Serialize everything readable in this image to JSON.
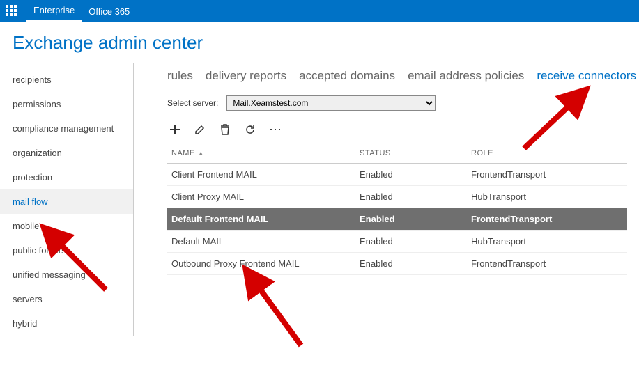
{
  "topbar": {
    "tabs": [
      "Enterprise",
      "Office 365"
    ],
    "active": 0
  },
  "page_title": "Exchange admin center",
  "sidebar": {
    "items": [
      "recipients",
      "permissions",
      "compliance management",
      "organization",
      "protection",
      "mail flow",
      "mobile",
      "public folders",
      "unified messaging",
      "servers",
      "hybrid"
    ],
    "active_index": 5
  },
  "main": {
    "tabs": [
      "rules",
      "delivery reports",
      "accepted domains",
      "email address policies",
      "receive connectors"
    ],
    "active_tab_index": 4,
    "server_label": "Select server:",
    "server_value": "Mail.Xeamstest.com",
    "table": {
      "columns": [
        "NAME",
        "STATUS",
        "ROLE"
      ],
      "rows": [
        {
          "name": "Client Frontend MAIL",
          "status": "Enabled",
          "role": "FrontendTransport",
          "selected": false
        },
        {
          "name": "Client Proxy MAIL",
          "status": "Enabled",
          "role": "HubTransport",
          "selected": false
        },
        {
          "name": "Default Frontend MAIL",
          "status": "Enabled",
          "role": "FrontendTransport",
          "selected": true
        },
        {
          "name": "Default MAIL",
          "status": "Enabled",
          "role": "HubTransport",
          "selected": false
        },
        {
          "name": "Outbound Proxy Frontend MAIL",
          "status": "Enabled",
          "role": "FrontendTransport",
          "selected": false
        }
      ]
    }
  }
}
